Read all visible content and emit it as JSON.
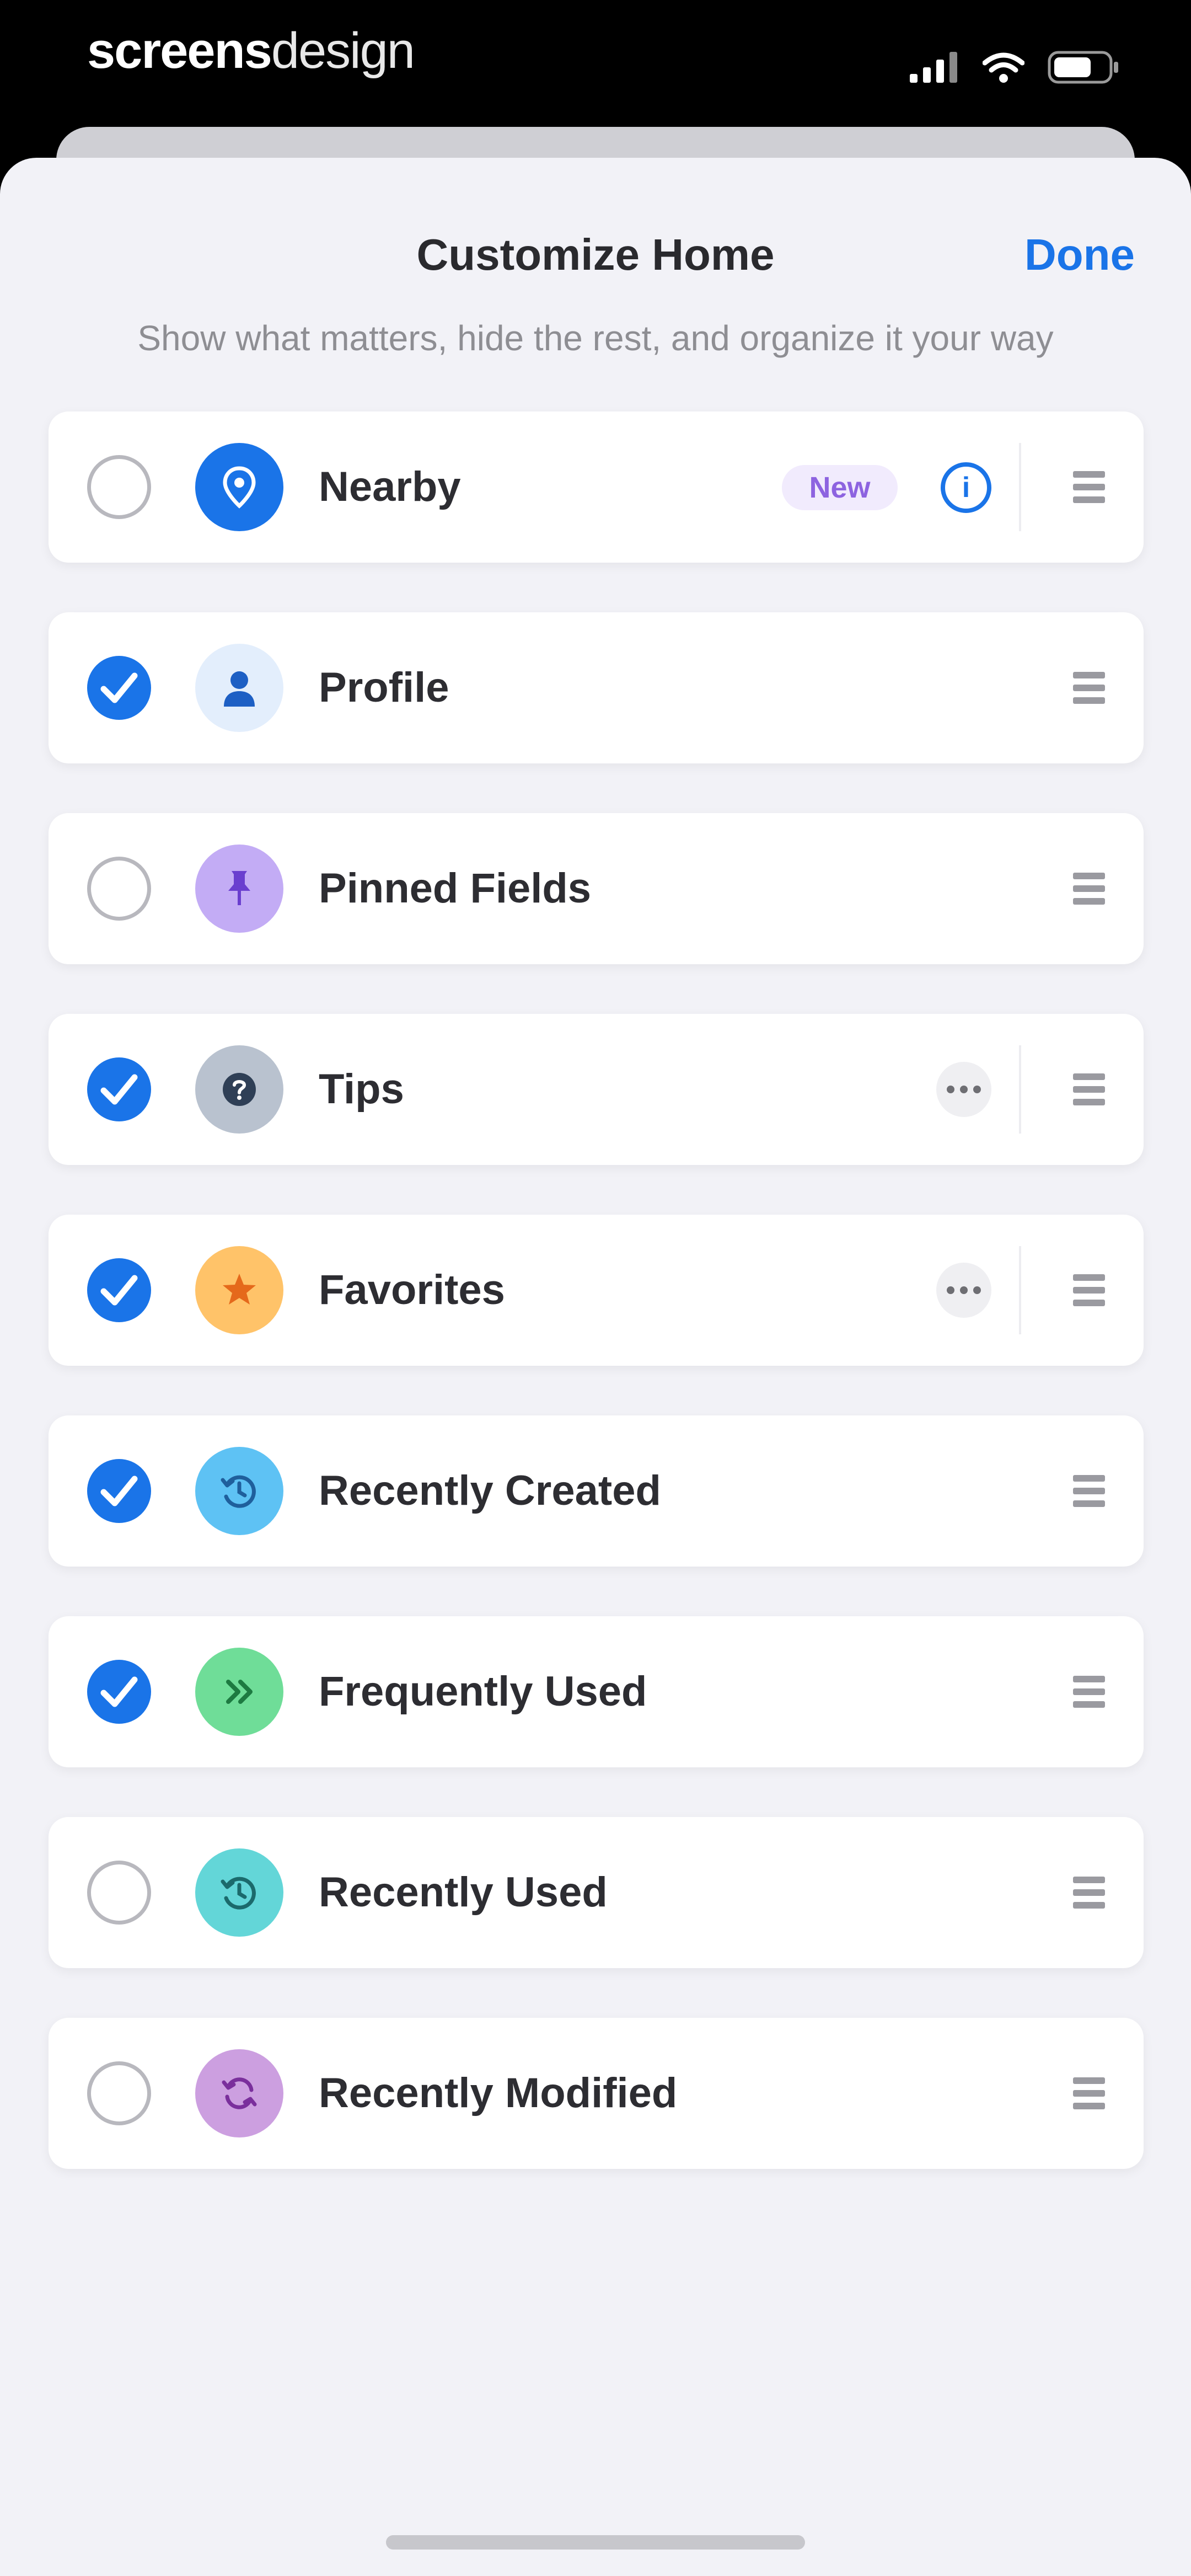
{
  "status_bar": {
    "brand_bold": "screens",
    "brand_light": "design",
    "icons": [
      "signal-icon",
      "wifi-icon",
      "battery-icon"
    ]
  },
  "header": {
    "title": "Customize Home",
    "done_label": "Done",
    "subtitle": "Show what matters, hide the rest, and organize it your way"
  },
  "colors": {
    "accent": "#1a74e8",
    "badge_text": "#8d63e0",
    "badge_bg": "#f1ebfd"
  },
  "items": [
    {
      "label": "Nearby",
      "checked": false,
      "icon": "location-pin-icon",
      "badge": "New",
      "action": "info"
    },
    {
      "label": "Profile",
      "checked": true,
      "icon": "person-icon"
    },
    {
      "label": "Pinned Fields",
      "checked": false,
      "icon": "pushpin-icon"
    },
    {
      "label": "Tips",
      "checked": true,
      "icon": "question-icon",
      "action": "more"
    },
    {
      "label": "Favorites",
      "checked": true,
      "icon": "star-icon",
      "action": "more"
    },
    {
      "label": "Recently Created",
      "checked": true,
      "icon": "history-icon"
    },
    {
      "label": "Frequently Used",
      "checked": true,
      "icon": "double-chevron-icon"
    },
    {
      "label": "Recently Used",
      "checked": false,
      "icon": "clock-back-icon"
    },
    {
      "label": "Recently Modified",
      "checked": false,
      "icon": "refresh-icon"
    }
  ]
}
